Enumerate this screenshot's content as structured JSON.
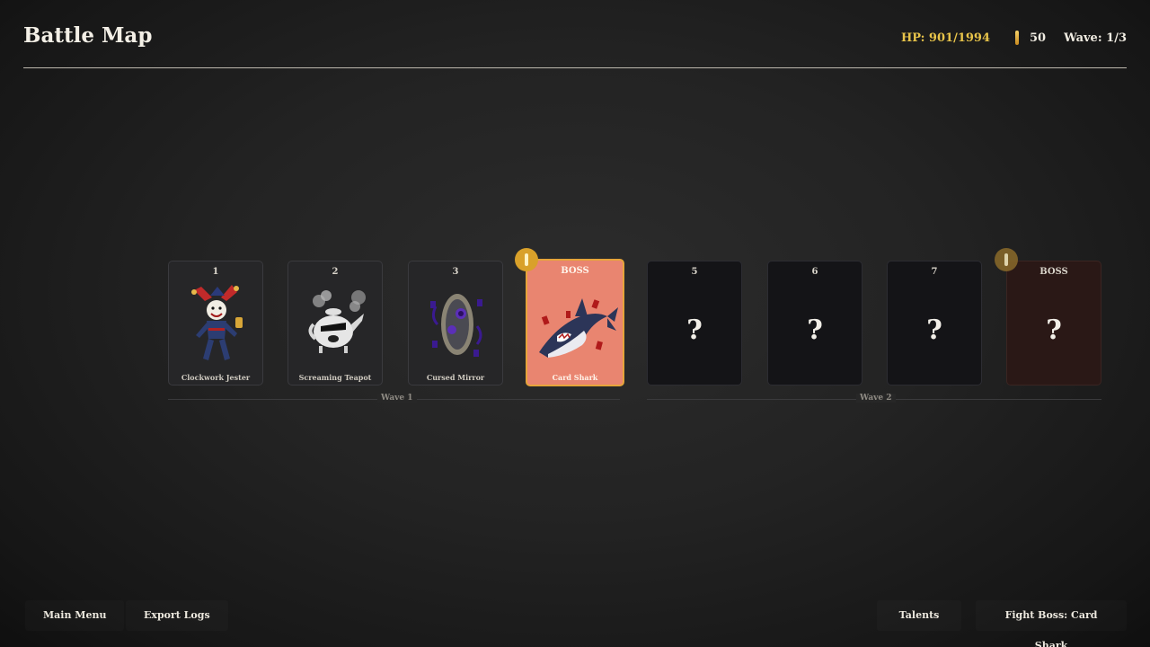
{
  "header": {
    "title": "Battle Map",
    "hp": "HP: 901/1994",
    "gold": "50",
    "wave": "Wave: 1/3",
    "hp_color": "#e8c44a"
  },
  "cards": [
    {
      "num": "1",
      "name": "Clockwork Jester",
      "state": "cleared",
      "art": "jester"
    },
    {
      "num": "2",
      "name": "Screaming Teapot",
      "state": "cleared",
      "art": "teapot"
    },
    {
      "num": "3",
      "name": "Cursed Mirror",
      "state": "cleared",
      "art": "mirror"
    },
    {
      "num": "BOSS",
      "name": "Card Shark",
      "state": "boss-current",
      "art": "shark",
      "badge": "gold-reward-icon"
    },
    {
      "num": "5",
      "name": "?",
      "state": "unknown"
    },
    {
      "num": "6",
      "name": "?",
      "state": "unknown"
    },
    {
      "num": "7",
      "name": "?",
      "state": "unknown"
    },
    {
      "num": "BOSS",
      "name": "?",
      "state": "boss-locked",
      "badge": "gold-reward-icon"
    }
  ],
  "waves": [
    "Wave 1",
    "Wave 2"
  ],
  "buttons": {
    "main_menu": "Main Menu",
    "export_logs": "Export Logs",
    "talents": "Talents",
    "fight_boss": "Fight Boss: Card Shark"
  },
  "colors": {
    "boss_card": "#e98570",
    "boss_border": "#e6a43a",
    "locked_boss": "#2a1816"
  }
}
